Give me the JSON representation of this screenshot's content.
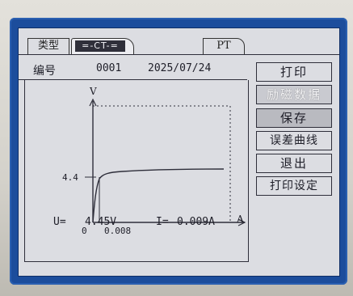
{
  "tabs": {
    "type_label": "类型",
    "ct_label": "=-CT-=",
    "pt_label": "PT"
  },
  "record": {
    "number_label": "编号",
    "number_value": "0001",
    "date": "2025/07/24"
  },
  "curve": {
    "y_axis_label": "V",
    "x_axis_label": "A",
    "y_tick": "4.4",
    "x_tick_origin": "0",
    "x_tick": "0.008",
    "knee_voltage": 4.4,
    "knee_current": 0.008
  },
  "readout": {
    "u_label": "U=",
    "u_value": "4.45V",
    "i_label": "I=",
    "i_value": "0.009A"
  },
  "buttons": [
    {
      "label": "打印"
    },
    {
      "label": "励磁数据"
    },
    {
      "label": "保存"
    },
    {
      "label": "误差曲线"
    },
    {
      "label": "退出"
    },
    {
      "label": "打印设定"
    }
  ],
  "colors": {
    "bezel_blue": "#1c4d9c",
    "lcd_background": "#dcdde2",
    "lcd_ink": "#2e2e3a"
  }
}
